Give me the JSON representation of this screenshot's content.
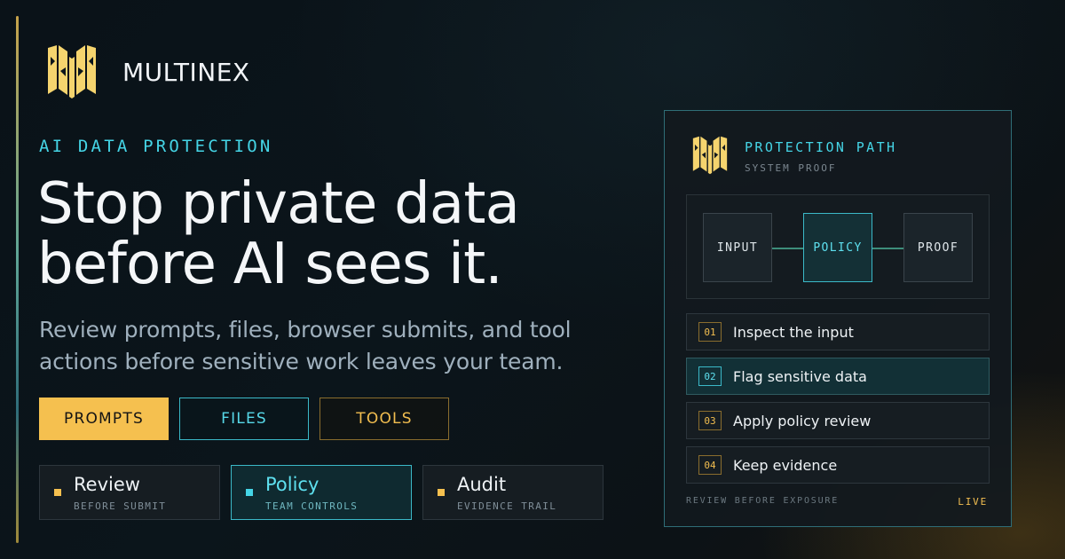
{
  "brand": {
    "name": "MULTINEX",
    "logo_icon": "multinex-logo-icon",
    "logo_color": "#f5d46e"
  },
  "hero": {
    "eyebrow": "AI DATA PROTECTION",
    "headline_line1": "Stop private data",
    "headline_line2": "before AI sees it.",
    "subhead_line1": "Review prompts, files, browser submits, and tool",
    "subhead_line2": "actions before sensitive work leaves your team."
  },
  "chips": [
    {
      "label": "PROMPTS",
      "state": "selected"
    },
    {
      "label": "FILES"
    },
    {
      "label": "TOOLS"
    }
  ],
  "features": [
    {
      "title": "Review",
      "subtitle": "BEFORE SUBMIT"
    },
    {
      "title": "Policy",
      "subtitle": "TEAM CONTROLS",
      "state": "selected"
    },
    {
      "title": "Audit",
      "subtitle": "EVIDENCE TRAIL"
    }
  ],
  "panel": {
    "title": "PROTECTION PATH",
    "subtitle": "SYSTEM PROOF",
    "flow": [
      "INPUT",
      "POLICY",
      "PROOF"
    ],
    "steps": [
      {
        "num": "01",
        "label": "Inspect the input"
      },
      {
        "num": "02",
        "label": "Flag sensitive data",
        "state": "active"
      },
      {
        "num": "03",
        "label": "Apply policy review"
      },
      {
        "num": "04",
        "label": "Keep evidence"
      }
    ],
    "footer": "REVIEW BEFORE EXPOSURE",
    "status": "LIVE"
  },
  "colors": {
    "accent_cyan": "#45d5e6",
    "accent_gold": "#f5c04f",
    "background": "#0b151b"
  }
}
